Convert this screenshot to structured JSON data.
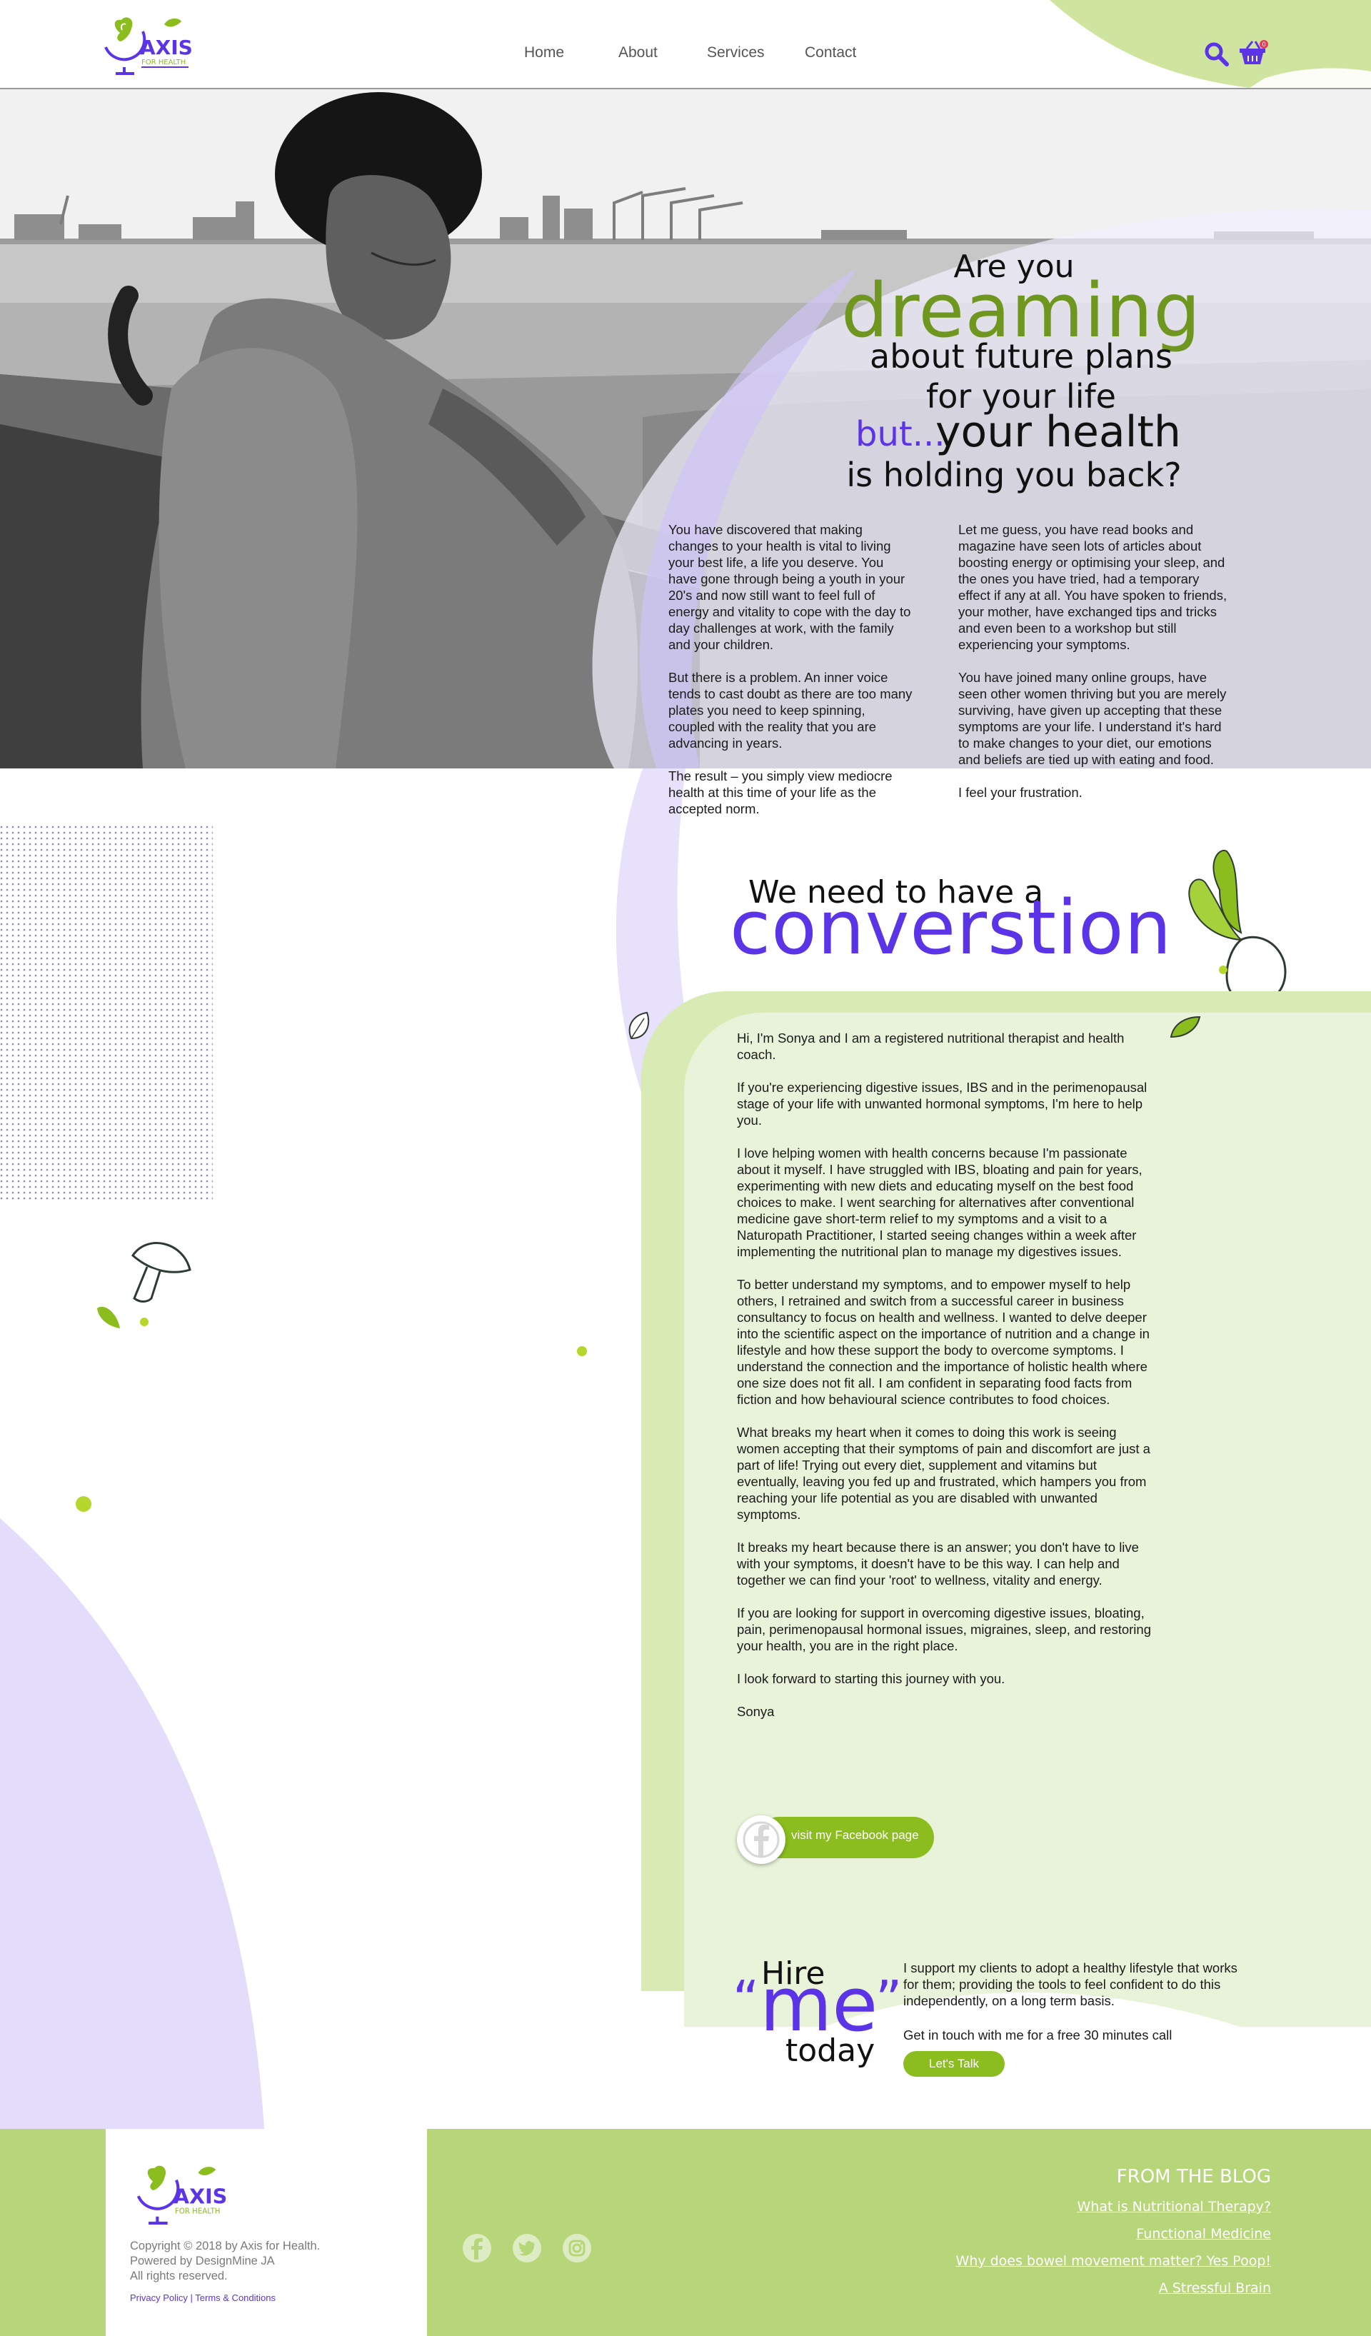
{
  "brand": {
    "name": "AXIS",
    "tagline": "FOR HEALTH",
    "colors": {
      "purple": "#5b34e8",
      "green": "#8bbd1e",
      "light_green": "#d9ebb5",
      "lavender": "#e3dcfb"
    }
  },
  "nav": {
    "items": [
      {
        "label": "Home"
      },
      {
        "label": "About"
      },
      {
        "label": "Services"
      },
      {
        "label": "Contact"
      }
    ],
    "search_icon": "search-icon",
    "cart_icon": "basket-icon",
    "cart_count": "0"
  },
  "hero": {
    "line1": "Are you",
    "line2": "dreaming",
    "line3": "about future plans",
    "line4": "for your life",
    "line5a": "but...",
    "line5b": "your health",
    "line6": "is holding you back?",
    "col1": [
      "You have discovered that making changes to your health is vital to living your best life, a life you deserve. You have gone through being a youth in your 20's and now still want to feel full of energy and vitality to cope with the day to day challenges at work, with the family and your children.",
      "But there is a problem. An inner voice tends to cast doubt as there are too many plates you need to keep spinning, coupled with the reality that you are advancing in years.",
      "The result  – you simply view mediocre health at this time of your life as the accepted norm."
    ],
    "col2": [
      "Let me guess, you have read books and magazine have seen lots of articles about boosting energy or optimising your sleep, and the ones you have tried, had a temporary effect if any at all. You have spoken to friends, your mother, have exchanged tips and tricks and even been to a workshop but still experiencing your symptoms.",
      "You have joined many online groups, have seen other women thriving but you are merely surviving, have given up accepting that these symptoms are your life.  I understand it's hard to make changes to your diet, our emotions and beliefs are tied up with eating and food.",
      "I feel your frustration."
    ]
  },
  "conversation": {
    "line1": "We need to have a",
    "line2": "converstion"
  },
  "about": {
    "paragraphs": [
      "Hi, I'm Sonya and I am a registered nutritional therapist and health coach.",
      "If you're experiencing digestive issues, IBS and in the perimenopausal stage of your life with unwanted hormonal symptoms, I'm here to help you.",
      "I love helping women with health concerns because I'm passionate about it myself. I have struggled with IBS, bloating and pain for years, experimenting with new diets and educating myself on the best food choices to make. I went searching for alternatives after conventional medicine gave short-term relief to my symptoms and a visit to a Naturopath Practitioner, I started seeing changes within a week after implementing the nutritional plan to manage my digestives issues.",
      "To better understand my symptoms, and to empower myself to help others, I  retrained and switch from a successful career in business consultancy to focus on health and wellness.  I wanted to delve deeper into the scientific aspect on the importance of nutrition and a change in lifestyle and how these support the body to overcome symptoms. I understand the connection and the importance of holistic health where one size does not fit all. I am confident in separating food facts from fiction and how behavioural science contributes to food choices.",
      "What breaks my heart when it comes to doing this work is seeing women accepting that their symptoms of pain and discomfort are just a part of life!  Trying out every diet, supplement and vitamins but eventually, leaving you fed up and frustrated, which hampers you from reaching your life potential as you are disabled with unwanted symptoms.",
      "It breaks my heart because there is an answer; you don't have to live with your symptoms, it doesn't have to be this way.  I can help and together we can find your 'root' to wellness, vitality and energy.",
      "If you are looking for support in overcoming digestive issues, bloating, pain, perimenopausal hormonal issues, migraines, sleep, and restoring your health, you are in the right place.",
      "I look forward to starting this journey with you.",
      "Sonya"
    ],
    "facebook_button": "visit my Facebook page"
  },
  "hire": {
    "word1": "Hire",
    "open_quote": "“",
    "word2": "me",
    "close_quote": "”",
    "word3": "today",
    "text1": "I support my clients to adopt a healthy lifestyle that works for them; providing the tools to feel confident to do this independently, on a long term basis.",
    "text2": "Get in touch with me for a free 30 minutes call",
    "button": "Let's Talk"
  },
  "footer": {
    "copyright": "Copyright © 2018 by Axis for Health.",
    "powered": "Powered by DesignMine JA",
    "rights": "All rights reserved.",
    "privacy": "Privacy Policy | Terms & Conditions",
    "social_icons": [
      "facebook-icon",
      "twitter-icon",
      "instagram-icon"
    ],
    "blog_title": "FROM THE BLOG",
    "blog_links": [
      "What is Nutritional Therapy?",
      "Functional Medicine",
      "Why does bowel movement matter? Yes Poop!",
      "A Stressful Brain"
    ]
  }
}
